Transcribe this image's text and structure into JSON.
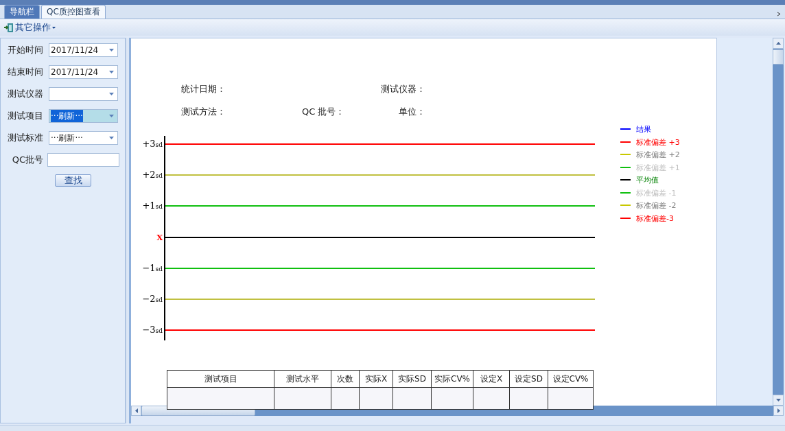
{
  "tabs": [
    {
      "label": "导航栏",
      "selected": false
    },
    {
      "label": "QC质控图查看",
      "selected": true
    }
  ],
  "toolbar": {
    "menu": "其它操作"
  },
  "filters": [
    {
      "label": "开始时间",
      "kind": "dropdown",
      "value": "2017/11/24",
      "highlighted": false
    },
    {
      "label": "结束时间",
      "kind": "dropdown",
      "value": "2017/11/24",
      "highlighted": false
    },
    {
      "label": "测试仪器",
      "kind": "dropdown",
      "highlighted": false
    },
    {
      "label": "测试项目",
      "kind": "dropdown",
      "value": "···刷新···",
      "highlighted": true
    },
    {
      "label": "测试标准",
      "kind": "dropdown",
      "value": "···刷新···",
      "highlighted": false
    },
    {
      "label": "QC批号",
      "kind": "text",
      "highlighted": false
    }
  ],
  "search_button": "查找",
  "report": {
    "header_rows": [
      [
        "统计日期：",
        "测试仪器："
      ],
      [
        "测试方法：",
        "QC 批号：",
        "单位："
      ]
    ],
    "sd_lines": [
      {
        "label": "+3",
        "unit": "sd",
        "color": "#ff0000",
        "kind": "sd"
      },
      {
        "label": "+2",
        "unit": "sd",
        "color": "#c0c040",
        "kind": "sd"
      },
      {
        "label": "+1",
        "unit": "sd",
        "color": "#10c010",
        "kind": "sd"
      },
      {
        "label": "X",
        "color": "#000000",
        "kind": "mean"
      },
      {
        "label": "−1",
        "unit": "sd",
        "color": "#10c010",
        "kind": "sd"
      },
      {
        "label": "−2",
        "unit": "sd",
        "color": "#c0c040",
        "kind": "sd"
      },
      {
        "label": "−3",
        "unit": "sd",
        "color": "#ff0000",
        "kind": "sd"
      }
    ],
    "legend": [
      {
        "label": "结果",
        "color": "#0000ff",
        "kind": "strong"
      },
      {
        "label": "标准偏差 +3",
        "color": "#ff0000",
        "kind": "strong"
      },
      {
        "label": "标准偏差 +2",
        "color": "#c8c800",
        "kind": "muted"
      },
      {
        "label": "标准偏差 +1",
        "color": "#10c010",
        "kind": "faint"
      },
      {
        "label": "平均值",
        "color": "#000000",
        "kind": "accent"
      },
      {
        "label": "标准偏差 -1",
        "color": "#10c010",
        "kind": "faint"
      },
      {
        "label": "标准偏差 -2",
        "color": "#c8c800",
        "kind": "muted"
      },
      {
        "label": "标准偏差-3",
        "color": "#ff0000",
        "kind": "strong"
      }
    ],
    "table": {
      "columns": [
        "测试项目",
        "测试水平",
        "次数",
        "实际X",
        "实际SD",
        "实际CV%",
        "设定X",
        "设定SD",
        "设定CV%"
      ]
    }
  }
}
